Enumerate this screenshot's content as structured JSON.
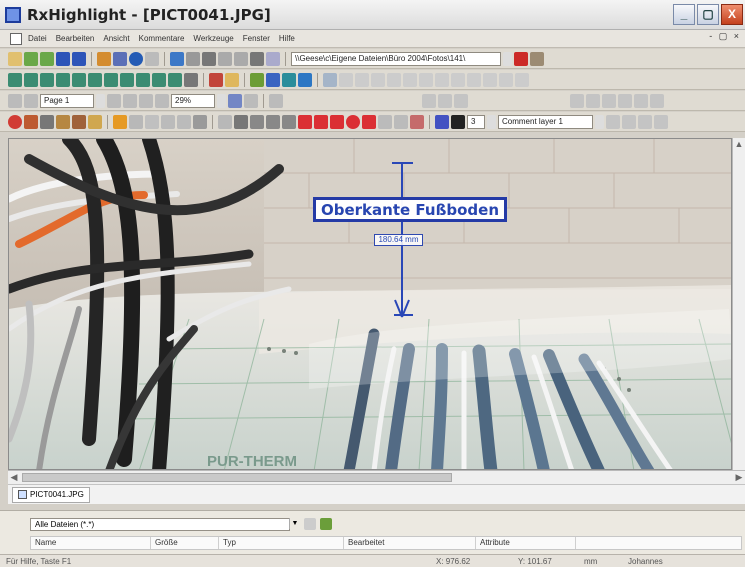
{
  "window": {
    "title": "RxHighlight - [PICT0041.JPG]",
    "buttons": [
      "_",
      "▢",
      "X"
    ]
  },
  "menubar": {
    "items": [
      "Datei",
      "Bearbeiten",
      "Ansicht",
      "Kommentare",
      "Werkzeuge",
      "Fenster",
      "Hilfe"
    ],
    "mdi_buttons": "- ▢ ×"
  },
  "toolbar2": {
    "path": "\\\\Geese\\c\\Eigene Dateien\\Büro 2004\\Fotos\\141\\"
  },
  "toolbar3": {
    "page": "Page 1",
    "zoom": "29%"
  },
  "toolbar5": {
    "line_width": "3",
    "layer": "Comment layer 1"
  },
  "annotation": {
    "label": "Oberkante Fußboden",
    "measurement": "180.64 mm",
    "floor_text": "PUR-THERM"
  },
  "tabs": [
    {
      "label": "PICT0041.JPG"
    }
  ],
  "browser": {
    "filter": "Alle Dateien (*.*)",
    "columns": [
      "Name",
      "Größe",
      "Typ",
      "Bearbeitet",
      "Attribute"
    ]
  },
  "status": {
    "help": "Für Hilfe, Taste F1",
    "x": "X: 976.62",
    "y": "Y: 101.67",
    "unit": "mm",
    "user": "Johannes"
  },
  "colors": {
    "annotation_blue": "#243aa6",
    "close_red": "#c4411e"
  }
}
